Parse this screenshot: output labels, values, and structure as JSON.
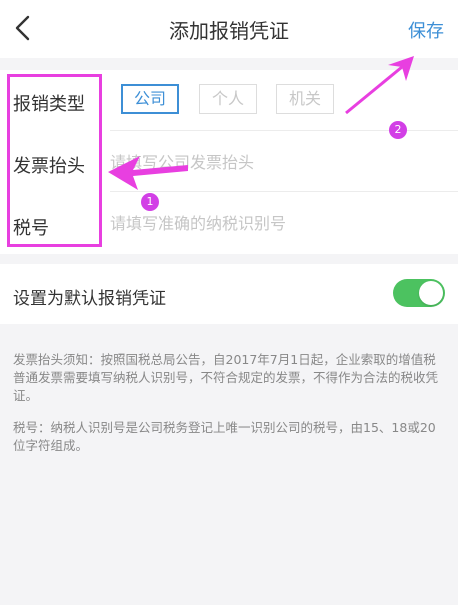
{
  "header": {
    "title": "添加报销凭证",
    "save_label": "保存"
  },
  "form": {
    "type_label": "报销类型",
    "type_options": [
      "公司",
      "个人",
      "机关"
    ],
    "selected_type": "公司",
    "invoice_title_label": "发票抬头",
    "invoice_title_placeholder": "请填写公司发票抬头",
    "tax_id_label": "税号",
    "tax_id_placeholder": "请填写准确的纳税识别号"
  },
  "default_setting": {
    "label": "设置为默认报销凭证",
    "enabled": true
  },
  "notes": {
    "invoice_note": "发票抬头须知：按照国税总局公告，自2017年7月1日起，企业索取的增值税普通发票需要填写纳税人识别号，不符合规定的发票，不得作为合法的税收凭证。",
    "tax_note": "税号：纳税人识别号是公司税务登记上唯一识别公司的税号，由15、18或20位字符组成。"
  },
  "annotations": {
    "badge_1": "1",
    "badge_2": "2",
    "color": "#e83fe0"
  }
}
